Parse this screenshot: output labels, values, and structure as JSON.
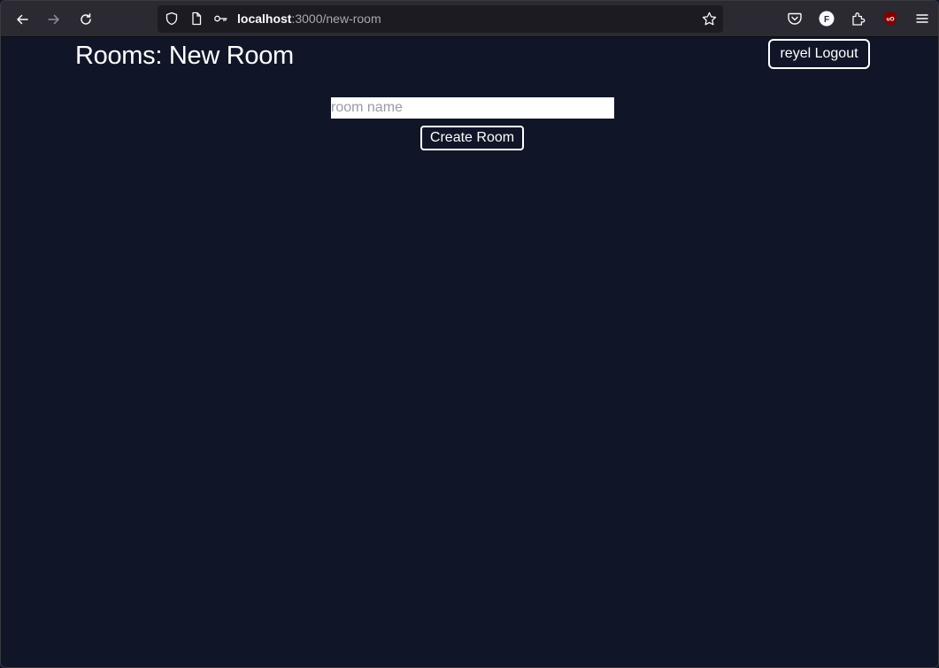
{
  "browser": {
    "url_host": "localhost",
    "url_path": ":3000/new-room",
    "icons": {
      "back": "back-arrow-icon",
      "forward": "forward-arrow-icon",
      "reload": "reload-icon",
      "shield": "tracking-shield-icon",
      "page": "page-icon",
      "key": "key-icon",
      "star": "bookmark-star-icon",
      "pocket": "pocket-icon",
      "account": "account-icon",
      "extensions": "extensions-puzzle-icon",
      "ublock": "ublock-origin-icon",
      "menu": "hamburger-menu-icon"
    },
    "account_letter": "F",
    "ublock_letters": "uO"
  },
  "page": {
    "title": "Rooms: New Room",
    "logout_label": "reyel Logout",
    "room_input": {
      "placeholder": "room name",
      "value": ""
    },
    "create_label": "Create Room"
  },
  "colors": {
    "background": "#101628",
    "toolbar": "#2b2a33",
    "urlbar": "#1c1b22",
    "text": "#ffffff",
    "placeholder": "#9a9ba3",
    "ublock_red": "#800000"
  }
}
